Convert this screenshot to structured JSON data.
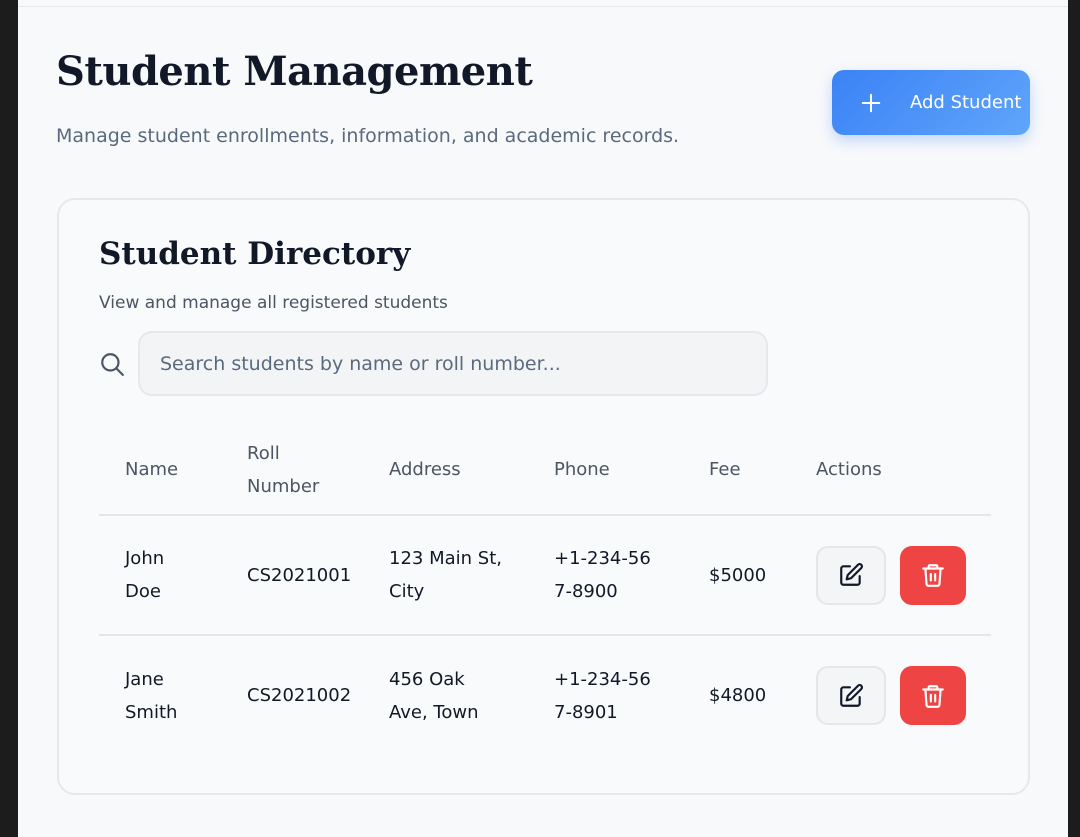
{
  "header": {
    "title": "Student Management",
    "subtitle": "Manage student enrollments, information, and academic records.",
    "add_button_label": "Add Student",
    "add_button_icon": "plus-icon"
  },
  "directory": {
    "title": "Student Directory",
    "subtitle": "View and manage all registered students",
    "search": {
      "placeholder": "Search students by name or roll number...",
      "value": "",
      "icon": "search-icon"
    },
    "columns": {
      "name": "Name",
      "roll": "Roll Number",
      "address": "Address",
      "phone": "Phone",
      "fee": "Fee",
      "actions": "Actions"
    },
    "rows": [
      {
        "name": "John Doe",
        "roll": "CS2021001",
        "address": "123 Main St, City",
        "phone": "+1-234-567-8900",
        "fee": "$5000"
      },
      {
        "name": "Jane Smith",
        "roll": "CS2021002",
        "address": "456 Oak Ave, Town",
        "phone": "+1-234-567-8901",
        "fee": "$4800"
      }
    ],
    "row_actions": {
      "edit_icon": "edit-icon",
      "delete_icon": "trash-icon"
    }
  },
  "colors": {
    "accent": "#3b82f6",
    "danger": "#ef4444",
    "text_primary": "#111827",
    "text_muted": "#5a6a7e"
  }
}
